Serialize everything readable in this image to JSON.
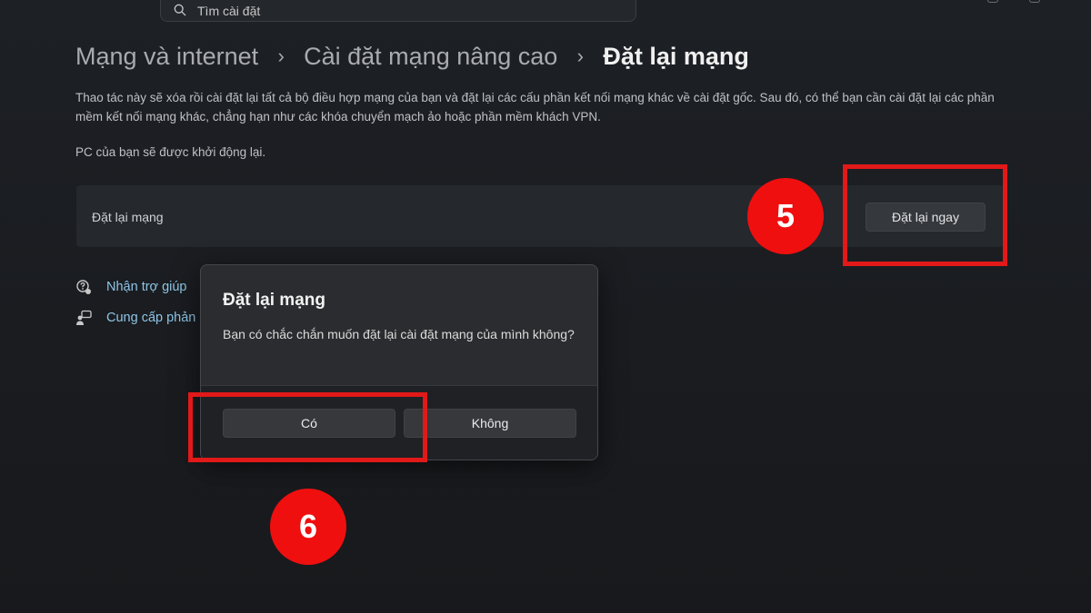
{
  "search": {
    "placeholder": "Tìm cài đặt"
  },
  "breadcrumb": {
    "items": [
      "Mạng và internet",
      "Cài đặt mạng nâng cao"
    ],
    "current": "Đặt lại mạng"
  },
  "description": "Thao tác này sẽ xóa rồi cài đặt lại tất cả bộ điều hợp mạng của bạn và đặt lại các cấu phần kết nối mạng khác về cài đặt gốc. Sau đó, có thể bạn cần cài đặt lại các phần mềm kết nối mạng khác, chẳng hạn như các khóa chuyển mạch ảo hoặc phần mềm khách VPN.",
  "restart_notice": "PC của bạn sẽ được khởi động lại.",
  "reset_card": {
    "label": "Đặt lại mạng",
    "button": "Đặt lại ngay"
  },
  "links": {
    "help": "Nhận trợ giúp",
    "feedback": "Cung cấp phản h"
  },
  "dialog": {
    "title": "Đặt lại mạng",
    "message": "Bạn có chắc chắn muốn đặt lại cài đặt mạng của mình không?",
    "yes": "Có",
    "no": "Không"
  },
  "annotations": {
    "step_5": "5",
    "step_6": "6",
    "highlight_color": "#e11919",
    "badge_color": "#ef0f0f"
  },
  "colors": {
    "background": "#1b1e22",
    "card": "#25282c",
    "link": "#8ec5e6",
    "dialog": "#2b2c2f"
  },
  "icons": {
    "search": "search-icon",
    "help": "help-icon",
    "feedback": "feedback-icon"
  }
}
